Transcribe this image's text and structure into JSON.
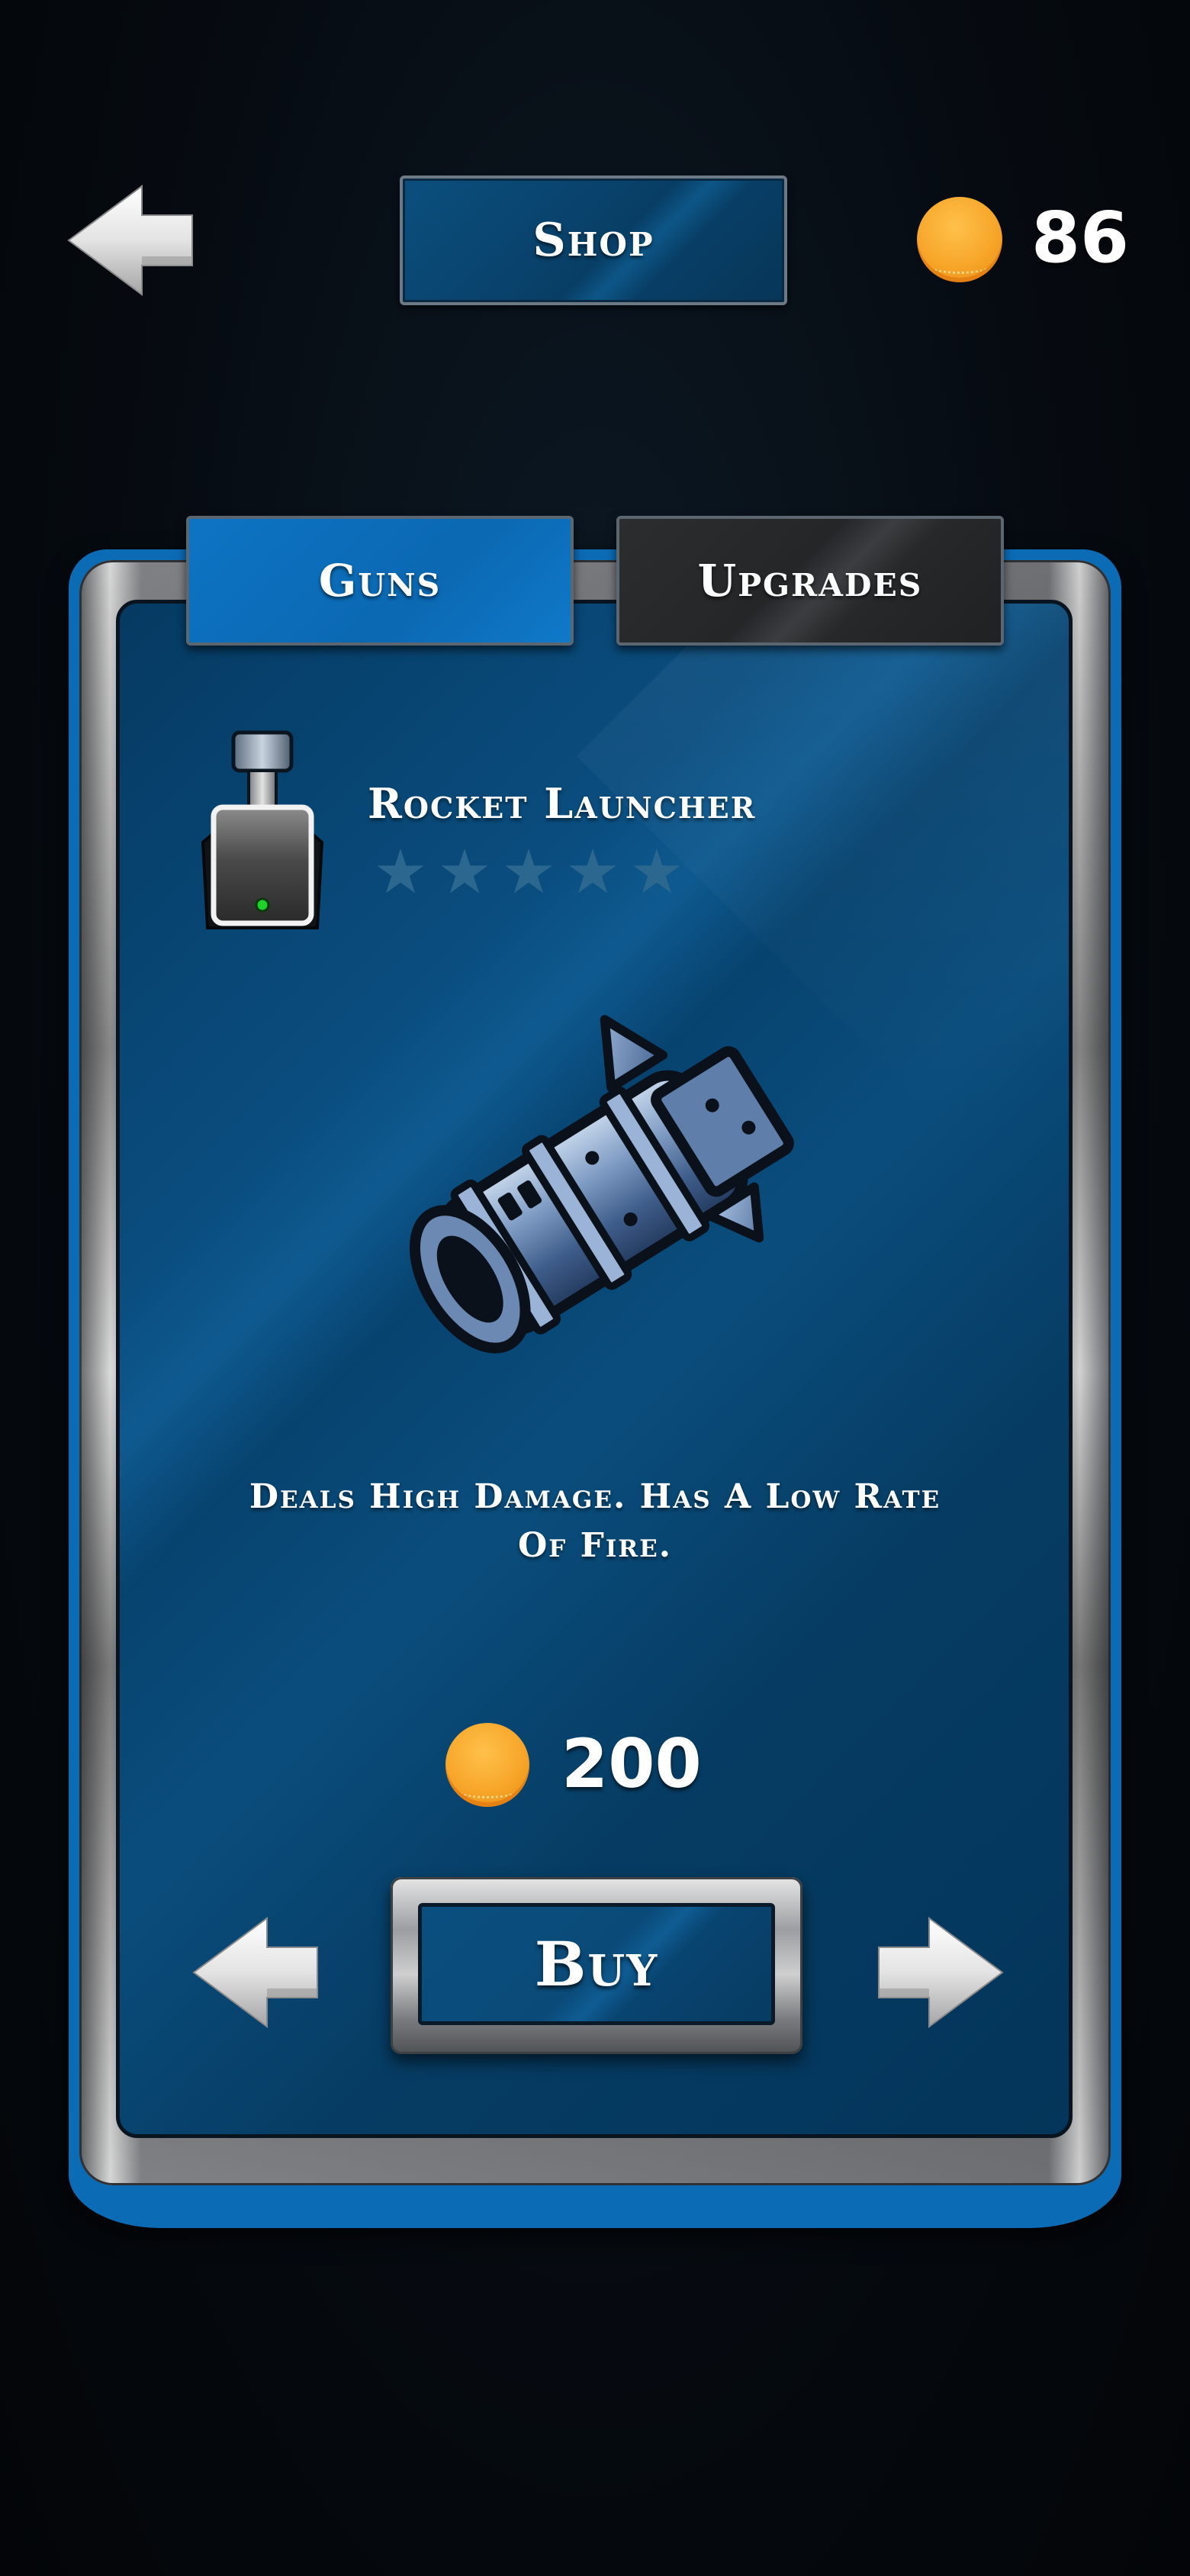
{
  "header": {
    "back_icon": "back-arrow-icon",
    "title": "Shop",
    "coin_icon": "coin-icon",
    "coin_balance": "86"
  },
  "tabs": [
    {
      "label": "Guns",
      "active": true
    },
    {
      "label": "Upgrades",
      "active": false
    }
  ],
  "item": {
    "icon": "gun-icon",
    "name": "Rocket Launcher",
    "rating": 0,
    "rating_max": 5,
    "image": "rocket-launcher-icon",
    "description": "Deals High Damage. Has A Low Rate Of Fire.",
    "price": "200"
  },
  "controls": {
    "prev_icon": "previous-arrow-icon",
    "next_icon": "next-arrow-icon",
    "buy_label": "Buy"
  },
  "colors": {
    "panel_blue": "#07436f",
    "tab_active": "#0b68b2",
    "tab_inactive": "#262829",
    "coin": "#f7a62a",
    "star_empty": "#2c6790",
    "text": "#ffffff"
  }
}
